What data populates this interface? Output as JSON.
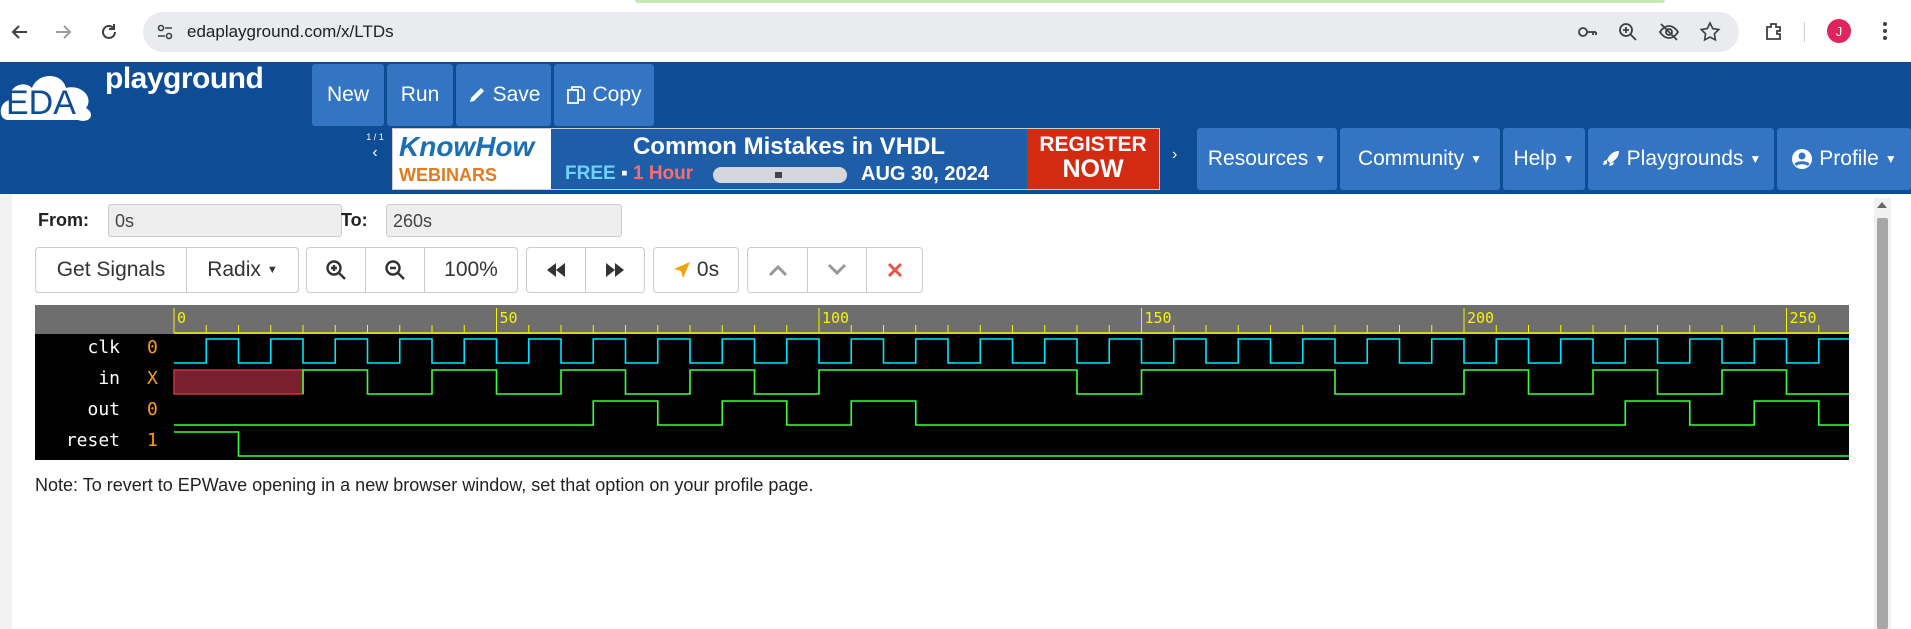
{
  "browser": {
    "url": "edaplayground.com/x/LTDs",
    "avatar_letter": "J"
  },
  "header": {
    "logo_eda": "EDA",
    "logo_playground": "playground",
    "buttons": {
      "new": "New",
      "run": "Run",
      "save": "Save",
      "copy": "Copy"
    },
    "pager": "1 / 1",
    "nav": {
      "resources": "Resources",
      "community": "Community",
      "help": "Help",
      "playgrounds": "Playgrounds",
      "profile": "Profile"
    }
  },
  "banner": {
    "know": "KnowHow",
    "webinars": "WEBINARS",
    "title": "Common Mistakes in VHDL",
    "free": "FREE",
    "hour": "1 Hour",
    "date": "AUG 30, 2024",
    "register1": "REGISTER",
    "register2": "NOW"
  },
  "range": {
    "from_label": "From:",
    "from_value": "0s",
    "to_label": "To:",
    "to_value": "260s"
  },
  "toolbar": {
    "get_signals": "Get Signals",
    "radix": "Radix",
    "zoom_level": "100%",
    "cursor_time": "0s"
  },
  "waveform": {
    "time_range": [
      0,
      260
    ],
    "ruler_labels": [
      "0",
      "50",
      "100",
      "150",
      "200",
      "250"
    ],
    "signals": [
      {
        "name": "clk",
        "value": "0",
        "color": "#00e5ff"
      },
      {
        "name": "in",
        "value": "X",
        "color": "#3cff3c"
      },
      {
        "name": "out",
        "value": "0",
        "color": "#3cff3c"
      },
      {
        "name": "reset",
        "value": "1",
        "color": "#3cff3c"
      }
    ],
    "clk_half_period": 5,
    "in_unknown_until": 20,
    "in_edges": [
      20,
      30,
      40,
      50,
      60,
      70,
      80,
      90,
      100,
      140,
      150,
      180,
      200,
      210,
      220,
      230,
      240,
      250
    ],
    "in_initial_after_x": 0,
    "out_edges": [
      65,
      75,
      85,
      95,
      105,
      115,
      225,
      235,
      245,
      255
    ],
    "out_initial": 0,
    "reset_edges": [
      10
    ],
    "reset_initial": 1
  },
  "note": "Note: To revert to EPWave opening in a new browser window, set that option on your profile page."
}
